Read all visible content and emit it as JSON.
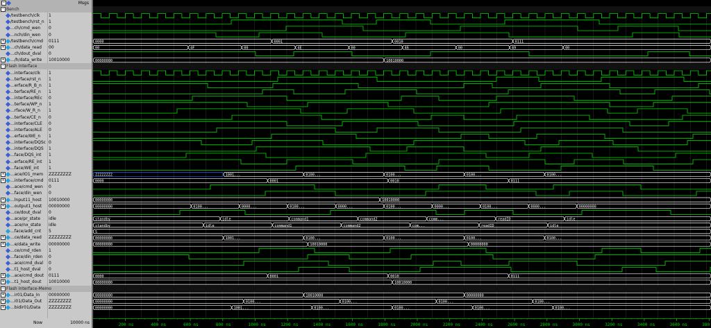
{
  "header": {
    "msgs_label": "Msgs"
  },
  "footer": {
    "now_label": "Now",
    "now_value": "10000 ns"
  },
  "timeline": {
    "units": "ns",
    "ticks": [
      "200 ns",
      "400 ns",
      "600 ns",
      "800 ns",
      "1000 ns",
      "1200 ns",
      "1400 ns",
      "1600 ns",
      "1800 ns",
      "2000 ns",
      "2200 ns",
      "2400 ns",
      "2600 ns",
      "2800 ns",
      "3000 ns",
      "3200 ns",
      "3400 ns",
      "3600 ns",
      "380"
    ]
  },
  "colors": {
    "wave": "#00e000",
    "bus": "#ffffff",
    "zvalue": "#2f5cff",
    "xvalue": "#ff2020",
    "magenta": "#ff00ff",
    "grid": "#2a2a2a"
  },
  "groups": [
    {
      "name": "Bench",
      "signals": [
        {
          "name": "/testbench/clk",
          "value": "1",
          "type": "bit",
          "expand": false
        },
        {
          "name": "/testbench/rst_n",
          "value": "1",
          "type": "bit",
          "expand": false
        },
        {
          "name": "...ch/cmd_wen",
          "value": "0",
          "type": "bit",
          "expand": false
        },
        {
          "name": "...nch/din_wen",
          "value": "0",
          "type": "bit",
          "expand": false
        },
        {
          "name": "/testbench/cmd",
          "value": "0111",
          "type": "bus",
          "expand": true,
          "segments": [
            "0000",
            "0001",
            "0010",
            "0111"
          ]
        },
        {
          "name": "...ch/data_read",
          "value": "00",
          "type": "bus",
          "expand": true,
          "segments": [
            "00",
            "4F",
            "00",
            "4E",
            "00",
            "46",
            "00",
            "49",
            "00"
          ]
        },
        {
          "name": "...ch/dout_dval",
          "value": "0",
          "type": "bit",
          "expand": false
        },
        {
          "name": ".../h/data_write",
          "value": "10010000",
          "type": "bus",
          "expand": true,
          "segments": [
            "00000000",
            "10010000"
          ]
        }
      ]
    },
    {
      "name": "Flash Interface",
      "signals": [
        {
          "name": "...interface/clk",
          "value": "1",
          "type": "bit",
          "expand": false
        },
        {
          "name": "...terface/rst_n",
          "value": "1",
          "type": "bit",
          "expand": false
        },
        {
          "name": "...erface/R_B_n",
          "value": "1",
          "type": "bit",
          "expand": false
        },
        {
          "name": "...terface/RE_n",
          "value": "1",
          "type": "bit",
          "expand": false
        },
        {
          "name": "...interface/REc",
          "value": "0",
          "type": "bit",
          "expand": false
        },
        {
          "name": "...terface/WP_n",
          "value": "1",
          "type": "bit",
          "expand": false
        },
        {
          "name": "...rface/W_R_n",
          "value": "1",
          "type": "bit",
          "expand": false
        },
        {
          "name": "...terface/CE_n",
          "value": "0",
          "type": "bit",
          "expand": false
        },
        {
          "name": "...interface/CLE",
          "value": "0",
          "type": "bit",
          "expand": false
        },
        {
          "name": "...interface/ALE",
          "value": "0",
          "type": "bit",
          "expand": false
        },
        {
          "name": "...erface/WE_n",
          "value": "1",
          "type": "bit",
          "expand": false
        },
        {
          "name": "...interface/DQSc",
          "value": "0",
          "type": "bit",
          "expand": false
        },
        {
          "name": "...interface/DQS",
          "value": "1",
          "type": "bit",
          "expand": false
        },
        {
          "name": "...face/DQS_int",
          "value": "1",
          "type": "bit",
          "expand": false
        },
        {
          "name": "...erface/RE_int",
          "value": "1",
          "type": "bit",
          "expand": false
        },
        {
          "name": "...face/WE_int",
          "value": "1",
          "type": "bit",
          "expand": false
        },
        {
          "name": "...ace/IO1_mem",
          "value": "ZZZZZZZZ",
          "type": "bus",
          "expand": true,
          "segments": [
            "ZZZZZZZZ",
            "1001...",
            "0100...",
            "0100...",
            "0100...",
            "0100..."
          ]
        },
        {
          "name": "...interface/cmd",
          "value": "0111",
          "type": "bus",
          "expand": true,
          "segments": [
            "0000",
            "0001",
            "0010",
            "0111"
          ]
        },
        {
          "name": "...ace/cmd_wen",
          "value": "0",
          "type": "bit",
          "expand": false
        },
        {
          "name": "...face/din_wen",
          "value": "0",
          "type": "bit",
          "expand": false
        },
        {
          "name": "...lnput11_host",
          "value": "10010000",
          "type": "bus",
          "expand": true,
          "segments": [
            "00000000",
            "10010000"
          ]
        },
        {
          "name": "...output1_host",
          "value": "00000000",
          "type": "bus",
          "expand": true,
          "segments": [
            "00000000",
            "0100...",
            "0000...",
            "0100...",
            "0000...",
            "0100...",
            "0000...",
            "0100...",
            "0000...",
            "00000000"
          ]
        },
        {
          "name": "...ce/dout_dval",
          "value": "0",
          "type": "bit",
          "expand": false
        },
        {
          "name": "...ace/pr_state",
          "value": "idle",
          "type": "enum",
          "expand": false,
          "segments": [
            "standby",
            "idle",
            "command1",
            "command2",
            "comm...",
            "readID",
            "idle"
          ]
        },
        {
          "name": "...ace/nx_state",
          "value": "idle",
          "type": "enum",
          "expand": false,
          "segments": [
            "standby",
            "idle",
            "command1",
            "command2",
            "com...",
            "readID",
            "idle"
          ]
        },
        {
          "name": "...face/add_cnt",
          "value": "5",
          "type": "bus",
          "expand": false,
          "segments": [
            "5"
          ]
        },
        {
          "name": "...ce/data_read",
          "value": "ZZZZZZZZ",
          "type": "bus",
          "expand": true,
          "segments": [
            "00000000",
            "1001...",
            "0100...",
            "0100...",
            "0100...",
            "0100..."
          ]
        },
        {
          "name": "...e/data_write",
          "value": "00000000",
          "type": "bus",
          "expand": true,
          "segments": [
            "00000000",
            "10010000",
            "00000000"
          ]
        },
        {
          "name": "...ce/cmd_rden",
          "value": "1",
          "type": "bit",
          "expand": false
        },
        {
          "name": "...face/din_rden",
          "value": "0",
          "type": "bit",
          "expand": false
        },
        {
          "name": "...ace/cmd_dval",
          "value": "0",
          "type": "bit",
          "expand": false
        },
        {
          "name": "...t1_host_dval",
          "value": "0",
          "type": "bit",
          "expand": false
        },
        {
          "name": "...ace/cmd_dout",
          "value": "0111",
          "type": "bus",
          "expand": true,
          "segments": [
            "0000",
            "0001",
            "0010",
            "0111"
          ]
        },
        {
          "name": "...t1_host_dout",
          "value": "10010000",
          "type": "bus",
          "expand": true,
          "segments": [
            "00000000",
            "10010000"
          ]
        }
      ]
    },
    {
      "name": "Flash Interface-Memo",
      "signals": [
        {
          "name": "...ir01/Data_In",
          "value": "00000000",
          "type": "bus",
          "expand": true,
          "segments": [
            "00000000",
            "10010000",
            "00000000"
          ]
        },
        {
          "name": "...i01/Data_Out",
          "value": "ZZZZZZZZ",
          "type": "bus",
          "expand": true,
          "segments": [
            "00000000",
            "0100...",
            "0100...",
            "0100...",
            "0100..."
          ]
        },
        {
          "name": "...bidir01/Data",
          "value": "ZZZZZZZZ",
          "type": "bus",
          "expand": true,
          "segments": [
            "00000000",
            "1001...",
            "0100...",
            "0100...",
            "0100...",
            "0100..."
          ]
        }
      ]
    }
  ]
}
